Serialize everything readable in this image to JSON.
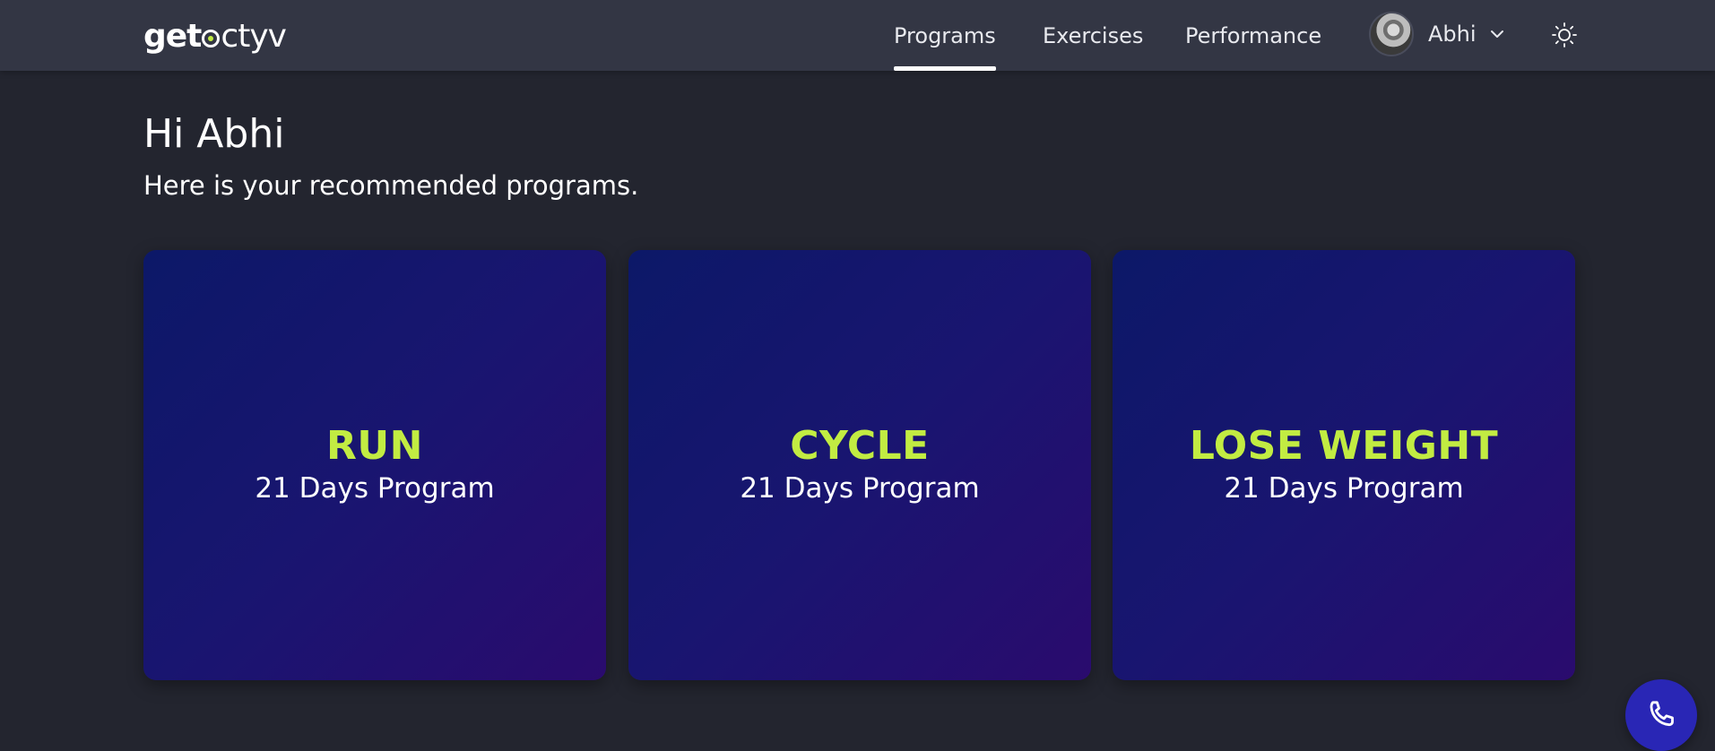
{
  "header": {
    "logo": {
      "part1": "get",
      "part2": "ctyv"
    },
    "nav": [
      {
        "label": "Programs",
        "active": true
      },
      {
        "label": "Exercises",
        "active": false
      },
      {
        "label": "Performance",
        "active": false
      }
    ],
    "user": {
      "name": "Abhi",
      "avatar_icon": "user-avatar",
      "menu_icon": "chevron-down-icon"
    },
    "theme_icon": "sun-icon"
  },
  "main": {
    "greeting": "Hi Abhi",
    "subtitle": "Here is your recommended programs.",
    "programs": [
      {
        "title": "RUN",
        "subtitle": "21 Days Program"
      },
      {
        "title": "CYCLE",
        "subtitle": "21 Days Program"
      },
      {
        "title": "LOSE WEIGHT",
        "subtitle": "21 Days Program"
      }
    ]
  },
  "support": {
    "icon": "phone-icon"
  },
  "colors": {
    "background": "#23252f",
    "header": "#333644",
    "accent": "#c2ec42",
    "card_start": "#0c1868",
    "card_end": "#2a0b6e",
    "call_button": "#2926b5"
  }
}
